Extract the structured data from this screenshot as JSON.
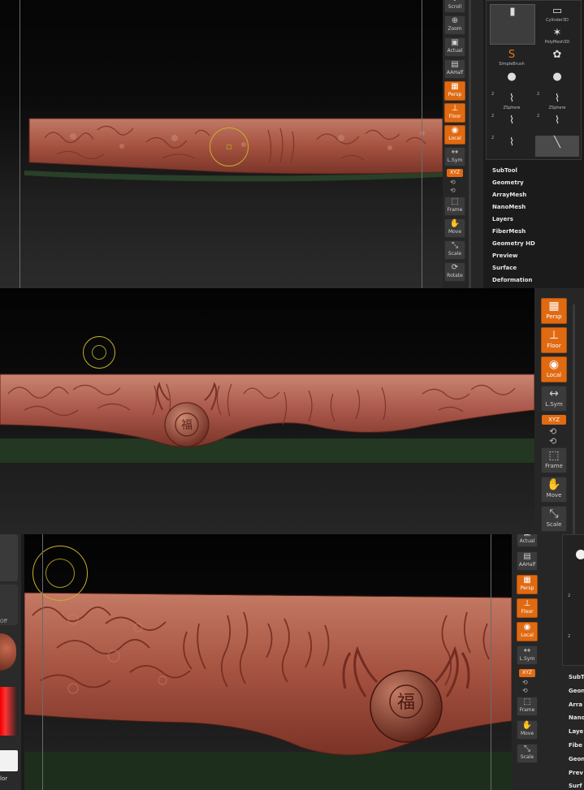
{
  "panel1": {
    "toolbar": [
      {
        "label": "Scroll",
        "icon": "scroll-icon",
        "on": false
      },
      {
        "label": "Zoom",
        "icon": "zoom-icon",
        "on": false
      },
      {
        "label": "Actual",
        "icon": "actual-icon",
        "on": false
      },
      {
        "label": "AAHalf",
        "icon": "aahalf-icon",
        "on": false
      },
      {
        "label": "Persp",
        "icon": "persp-icon",
        "on": true
      },
      {
        "label": "Floor",
        "icon": "floor-icon",
        "on": true
      },
      {
        "label": "Local",
        "icon": "local-icon",
        "on": true
      },
      {
        "label": "L.Sym",
        "icon": "lsym-icon",
        "on": false
      },
      {
        "label": "XYZ",
        "icon": "xyz-icon",
        "on": true
      },
      {
        "label": "Frame",
        "icon": "frame-icon",
        "on": false
      },
      {
        "label": "Move",
        "icon": "move-icon",
        "on": false
      },
      {
        "label": "Scale",
        "icon": "scale-icon",
        "on": false
      },
      {
        "label": "Rotate",
        "icon": "rotate-icon",
        "on": false
      }
    ],
    "tools": [
      {
        "label": "",
        "glyph": "▮",
        "count": ""
      },
      {
        "label": "Cylinder3D",
        "glyph": "▭",
        "count": ""
      },
      {
        "label": "",
        "glyph": "",
        "count": ""
      },
      {
        "label": "PolyMesh3D",
        "glyph": "✶",
        "count": ""
      },
      {
        "label": "SimpleBrush",
        "glyph": "S",
        "count": "",
        "orange": true
      },
      {
        "label": "",
        "glyph": "✿",
        "count": ""
      },
      {
        "label": "",
        "glyph": "●",
        "count": ""
      },
      {
        "label": "",
        "glyph": "●",
        "count": ""
      },
      {
        "label": "ZSphere",
        "glyph": "⌇",
        "count": "2"
      },
      {
        "label": "ZSphere",
        "glyph": "⌇",
        "count": "2"
      },
      {
        "label": "",
        "glyph": "⌇",
        "count": "2"
      },
      {
        "label": "",
        "glyph": "⌇",
        "count": "2"
      },
      {
        "label": "",
        "glyph": "⌇",
        "count": "2"
      },
      {
        "label": "",
        "glyph": "╲",
        "count": ""
      }
    ],
    "menu": [
      "SubTool",
      "Geometry",
      "ArrayMesh",
      "NanoMesh",
      "Layers",
      "FiberMesh",
      "Geometry HD",
      "Preview",
      "Surface",
      "Deformation"
    ]
  },
  "panel2": {
    "toolbar": [
      {
        "label": "Persp",
        "icon": "persp-icon",
        "on": true
      },
      {
        "label": "Floor",
        "icon": "floor-icon",
        "on": true
      },
      {
        "label": "Local",
        "icon": "local-icon",
        "on": true
      },
      {
        "label": "L.Sym",
        "icon": "lsym-icon",
        "on": false
      },
      {
        "label": "XYZ",
        "icon": "xyz-icon",
        "on": true
      },
      {
        "label": "Frame",
        "icon": "frame-icon",
        "on": false
      },
      {
        "label": "Move",
        "icon": "move-icon",
        "on": false
      },
      {
        "label": "Scale",
        "icon": "scale-icon",
        "on": false
      }
    ]
  },
  "panel3": {
    "toolbar": [
      {
        "label": "Actual",
        "icon": "actual-icon",
        "on": false
      },
      {
        "label": "AAHalf",
        "icon": "aahalf-icon",
        "on": false
      },
      {
        "label": "Persp",
        "icon": "persp-icon",
        "on": true
      },
      {
        "label": "Floor",
        "icon": "floor-icon",
        "on": true
      },
      {
        "label": "Local",
        "icon": "local-icon",
        "on": true
      },
      {
        "label": "L.Sym",
        "icon": "lsym-icon",
        "on": false
      },
      {
        "label": "XYZ",
        "icon": "xyz-icon",
        "on": true
      },
      {
        "label": "Frame",
        "icon": "frame-icon",
        "on": false
      },
      {
        "label": "Move",
        "icon": "move-icon",
        "on": false
      },
      {
        "label": "Scale",
        "icon": "scale-icon",
        "on": false
      }
    ],
    "menu": [
      "SubT",
      "Geon",
      "Arra",
      "Nano",
      "Laye",
      "Fibe",
      "Geon",
      "Prev",
      "Surf"
    ],
    "left_labels": [
      "Off",
      "lor"
    ],
    "emblem_char": "福"
  },
  "colors": {
    "accent": "#e06a12",
    "relief": "#a5503f",
    "relief_light": "#c4745f",
    "floor_green": "#2c4a2a"
  }
}
